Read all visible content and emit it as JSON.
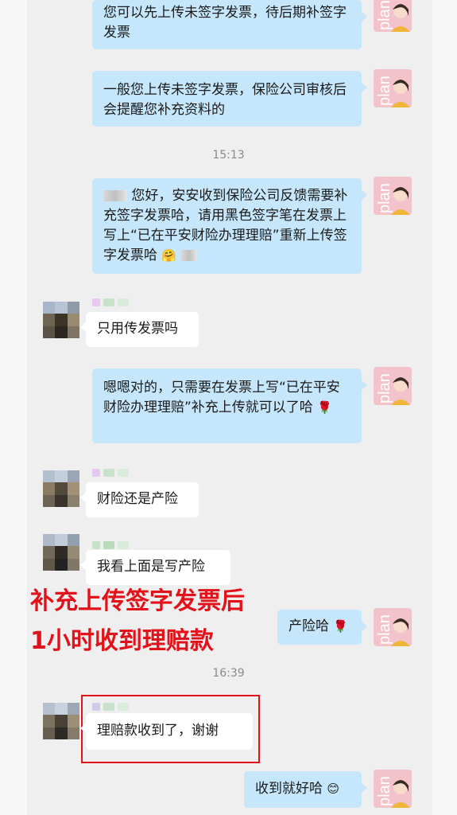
{
  "messages": {
    "m1": "您可以先上传未签字发票，待后期补签字发票",
    "m2": "一般您上传未签字发票，保险公司审核后会提醒您补充资料的",
    "t1": "15:13",
    "m3": "您好，安安收到保险公司反馈需要补充签字发票哈，请用黑色签字笔在发票上写上“已在平安财险办理理赔”重新上传签字发票哈",
    "m4": "只用传发票吗",
    "m5": "嗯嗯对的，只需要在发票上写“已在平安财险办理理赔”补充上传就可以了哈",
    "m6": "财险还是产险",
    "m7": "我看上面是写产险",
    "m8": "产险哈",
    "t2": "16:39",
    "m9": "理赔款收到了，谢谢",
    "m10": "收到就好哈"
  },
  "annotation": {
    "line1": "补充上传签字发票后",
    "line2": "1小时收到理赔款"
  },
  "avatar": {
    "agent_text": "plan"
  },
  "emoji": {
    "rose": "🌹",
    "hug": "🤗",
    "smile": "😊"
  },
  "colors": {
    "outgoing_bubble": "#c6e6fb",
    "incoming_bubble": "#ffffff",
    "annotation_red": "#e3121a",
    "agent_avatar_bg": "#f3c3cc"
  }
}
